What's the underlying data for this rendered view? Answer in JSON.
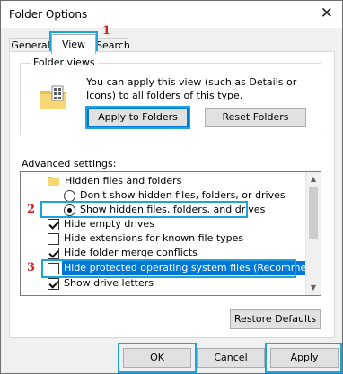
{
  "window": {
    "title": "Folder Options",
    "close_glyph": "✕"
  },
  "tabs": [
    {
      "label": "General",
      "active": false
    },
    {
      "label": "View",
      "active": true
    },
    {
      "label": "Search",
      "active": false
    }
  ],
  "markers": {
    "one": "1",
    "two": "2",
    "three": "3"
  },
  "folder_views": {
    "label": "Folder views",
    "description": "You can apply this view (such as Details or Icons) to all folders of this type.",
    "apply_button": "Apply to Folders",
    "reset_button": "Reset Folders"
  },
  "advanced": {
    "label": "Advanced settings:",
    "items": [
      {
        "type": "folder",
        "label": "Hidden files and folders"
      },
      {
        "type": "radio",
        "label": "Don't show hidden files, folders, or drives",
        "selected": false
      },
      {
        "type": "radio",
        "label": "Show hidden files, folders, and drives",
        "selected": true
      },
      {
        "type": "checkbox",
        "label": "Hide empty drives",
        "checked": true
      },
      {
        "type": "checkbox",
        "label": "Hide extensions for known file types",
        "checked": false
      },
      {
        "type": "checkbox",
        "label": "Hide folder merge conflicts",
        "checked": true
      },
      {
        "type": "checkbox",
        "label": "Hide protected operating system files (Recommended)",
        "checked": false
      },
      {
        "type": "checkbox",
        "label": "Show drive letters",
        "checked": true
      }
    ]
  },
  "buttons": {
    "restore_defaults": "Restore Defaults",
    "ok": "OK",
    "cancel": "Cancel",
    "apply": "Apply"
  },
  "colors": {
    "highlight": "#1ea3dc",
    "marker": "#d32020",
    "selection": "#0078d7",
    "focus": "#0078d7"
  },
  "icons": {
    "folder": "folder-icon",
    "view_icon": "folder-view-icon",
    "close": "close-icon"
  }
}
